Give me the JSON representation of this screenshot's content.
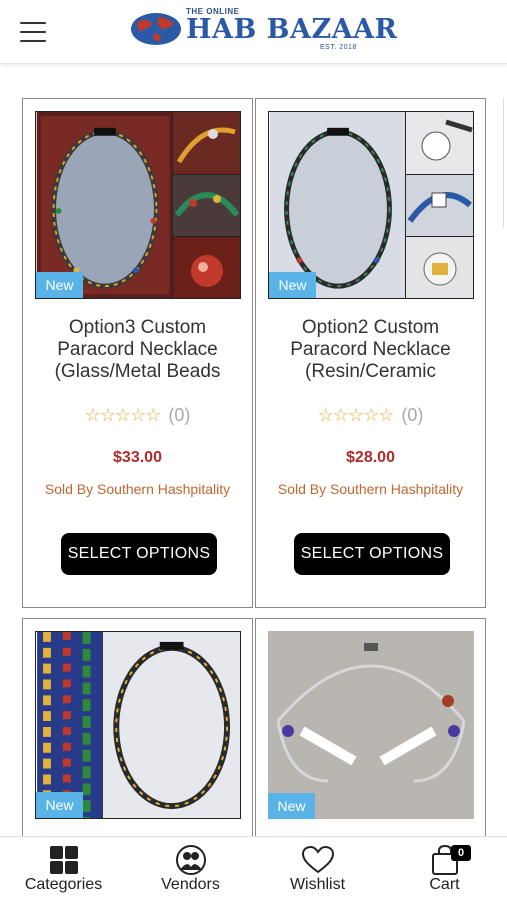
{
  "header": {
    "menu_icon": "hamburger-icon",
    "logo_top": "THE ONLINE",
    "logo_name": "HAB BAZAAR",
    "logo_est": "EST. 2018"
  },
  "products": [
    {
      "badge": "New",
      "title": "Option3 Custom Paracord Necklace (Glass/Metal Beads",
      "stars": "☆☆☆☆☆",
      "rating_count": "(0)",
      "price": "$33.00",
      "vendor": "Sold By Southern Hashpitality",
      "button": "SELECT OPTIONS"
    },
    {
      "badge": "New",
      "title": "Option2 Custom Paracord Necklace (Resin/Ceramic",
      "stars": "☆☆☆☆☆",
      "rating_count": "(0)",
      "price": "$28.00",
      "vendor": "Sold By Southern Hashpitality",
      "button": "SELECT OPTIONS"
    },
    {
      "badge": "New"
    },
    {
      "badge": "New"
    }
  ],
  "tabbar": {
    "categories": "Categories",
    "vendors": "Vendors",
    "wishlist": "Wishlist",
    "cart": "Cart",
    "cart_count": "0"
  },
  "colors": {
    "price": "#b22b2b",
    "vendor": "#c0662e",
    "badge": "#5ab3e6",
    "star": "#e0b23a",
    "button": "#000000"
  }
}
